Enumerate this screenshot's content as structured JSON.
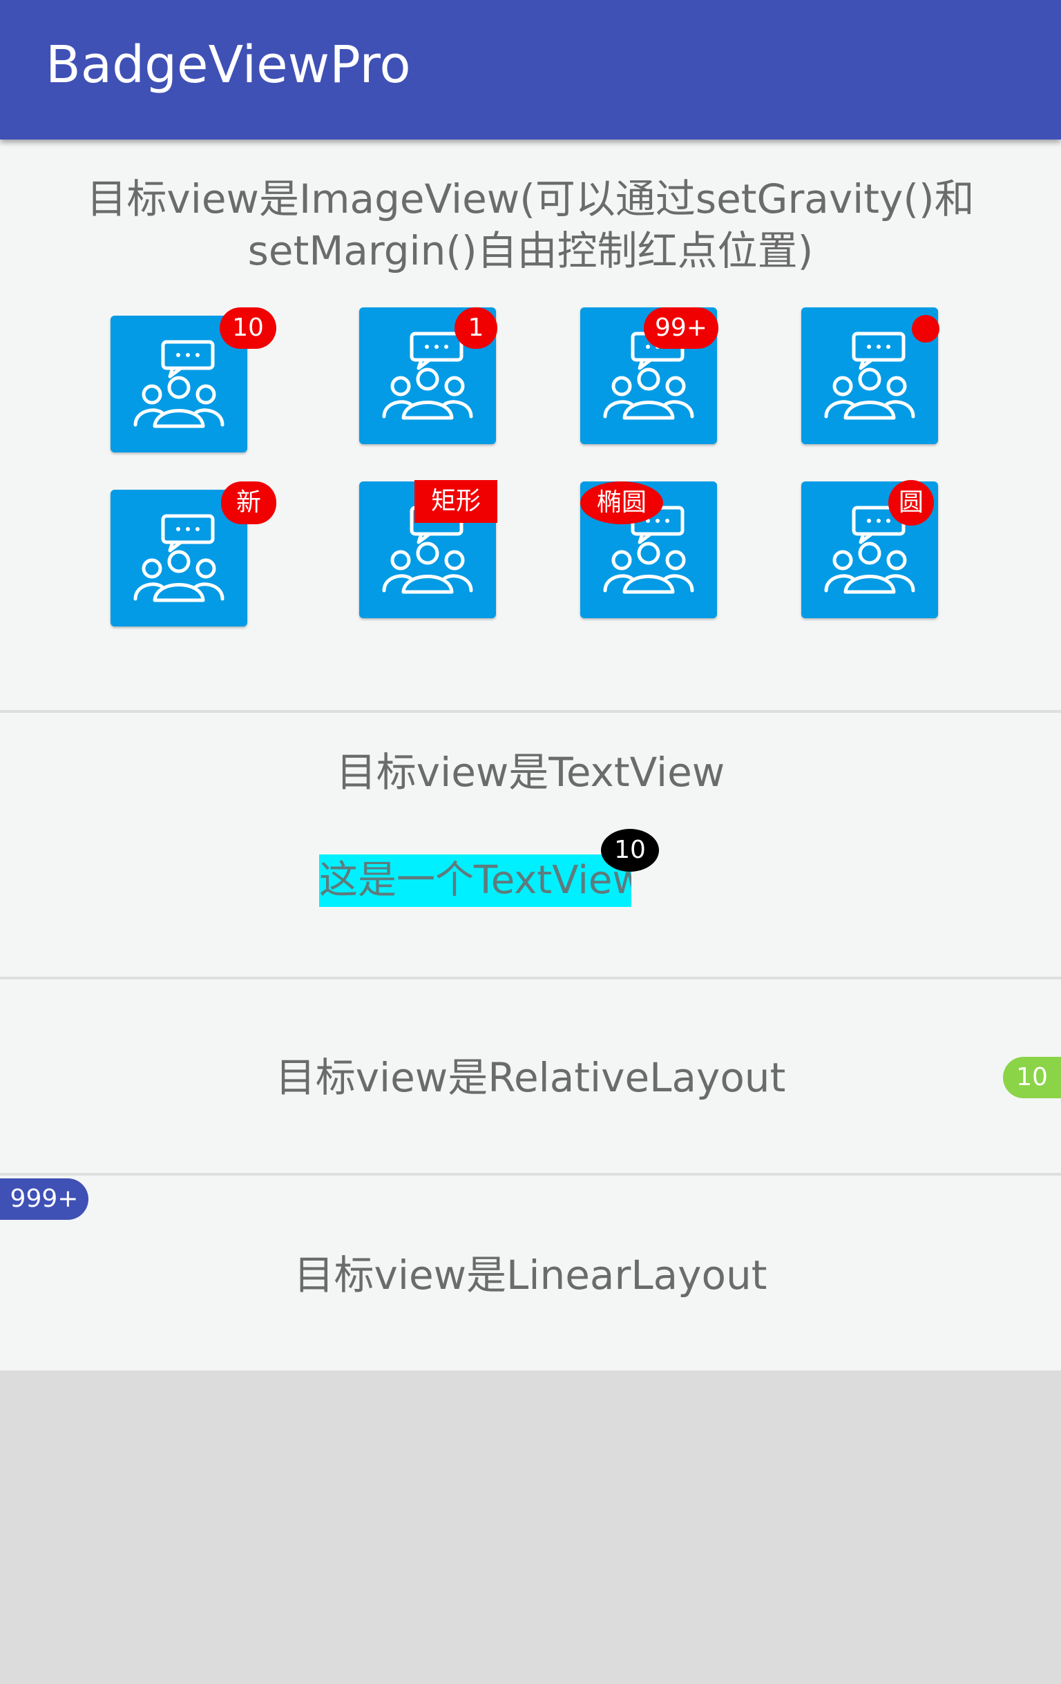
{
  "app": {
    "title": "BadgeViewPro"
  },
  "colors": {
    "app_bar": "#3f51b5",
    "tile": "#039be5",
    "badge_red": "#f00000",
    "badge_black": "#000000",
    "badge_green": "#8bd448",
    "badge_indigo": "#3f51b5",
    "textview_bg": "#00f0ff"
  },
  "sections": {
    "imageview": {
      "title_line1": "目标view是ImageView(可以通过setGravity()和",
      "title_line2": "setMargin()自由控制红点位置)",
      "tile_icon": "group-chat-icon",
      "badges": [
        "10",
        "1",
        "99+",
        "",
        "新",
        "矩形",
        "椭圆",
        "圆"
      ]
    },
    "textview": {
      "title": "目标view是TextView",
      "target_text": "这是一个TextView",
      "badge": "10"
    },
    "relativelayout": {
      "title": "目标view是RelativeLayout",
      "badge": "10"
    },
    "linearlayout": {
      "title": "目标view是LinearLayout",
      "badge": "999+"
    }
  }
}
